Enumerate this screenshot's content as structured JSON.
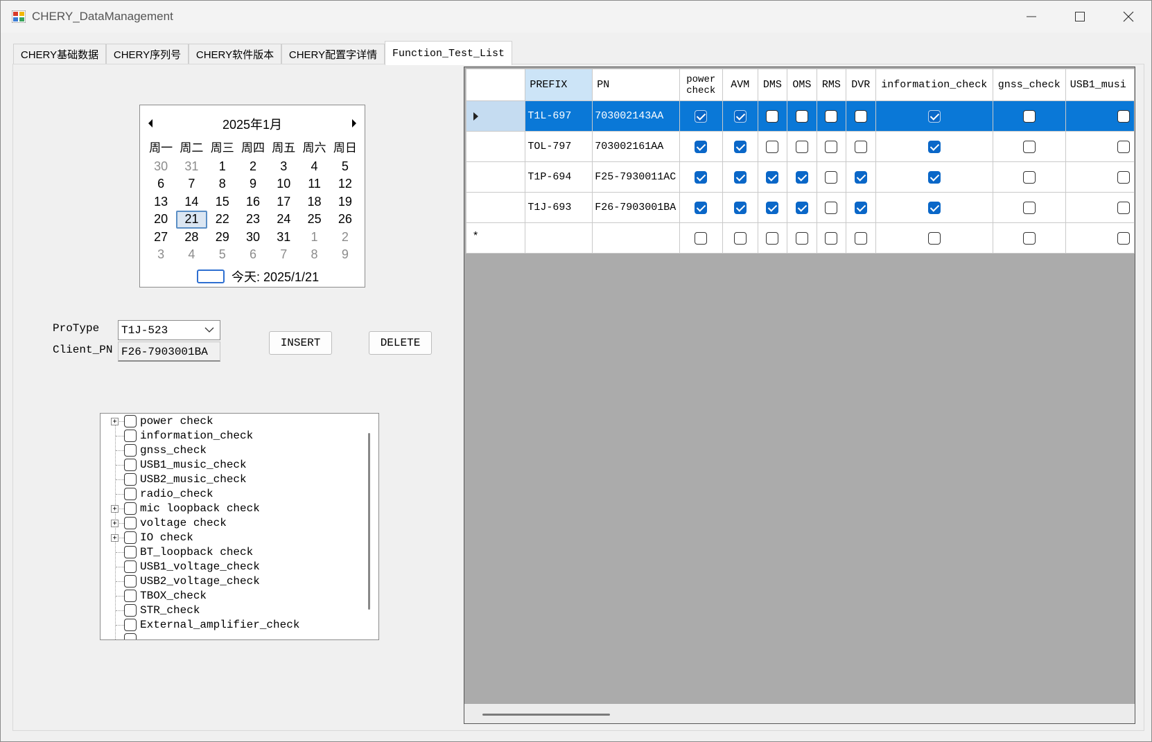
{
  "window": {
    "title": "CHERY_DataManagement"
  },
  "tabs": [
    {
      "label": "CHERY基础数据",
      "active": false
    },
    {
      "label": "CHERY序列号",
      "active": false
    },
    {
      "label": "CHERY软件版本",
      "active": false
    },
    {
      "label": "CHERY配置字详情",
      "active": false
    },
    {
      "label": "Function_Test_List",
      "active": true
    }
  ],
  "calendar": {
    "month_label": "2025年1月",
    "weekdays": [
      "周一",
      "周二",
      "周三",
      "周四",
      "周五",
      "周六",
      "周日"
    ],
    "weeks": [
      [
        "30",
        "31",
        "1",
        "2",
        "3",
        "4",
        "5"
      ],
      [
        "6",
        "7",
        "8",
        "9",
        "10",
        "11",
        "12"
      ],
      [
        "13",
        "14",
        "15",
        "16",
        "17",
        "18",
        "19"
      ],
      [
        "20",
        "21",
        "22",
        "23",
        "24",
        "25",
        "26"
      ],
      [
        "27",
        "28",
        "29",
        "30",
        "31",
        "1",
        "2"
      ],
      [
        "3",
        "4",
        "5",
        "6",
        "7",
        "8",
        "9"
      ]
    ],
    "today_label": "今天: 2025/1/21"
  },
  "form": {
    "protype_label": "ProType",
    "protype_value": "T1J-523",
    "client_pn_label": "Client_PN",
    "client_pn_value": "F26-7903001BA",
    "insert_label": "INSERT",
    "delete_label": "DELETE"
  },
  "tree": {
    "items": [
      {
        "label": "power check",
        "expandable": true
      },
      {
        "label": "information_check",
        "expandable": false
      },
      {
        "label": "gnss_check",
        "expandable": false
      },
      {
        "label": "USB1_music_check",
        "expandable": false
      },
      {
        "label": "USB2_music_check",
        "expandable": false
      },
      {
        "label": "radio_check",
        "expandable": false
      },
      {
        "label": "mic loopback check",
        "expandable": true
      },
      {
        "label": "voltage check",
        "expandable": true
      },
      {
        "label": "IO check",
        "expandable": true
      },
      {
        "label": "BT_loopback check",
        "expandable": false
      },
      {
        "label": "USB1_voltage_check",
        "expandable": false
      },
      {
        "label": "USB2_voltage_check",
        "expandable": false
      },
      {
        "label": "TBOX_check",
        "expandable": false
      },
      {
        "label": "STR_check",
        "expandable": false
      },
      {
        "label": "External_amplifier_check",
        "expandable": false
      }
    ]
  },
  "grid": {
    "columns": [
      "PREFIX",
      "PN",
      "power check",
      "AVM",
      "DMS",
      "OMS",
      "RMS",
      "DVR",
      "information_check",
      "gnss_check",
      "USB1_musi"
    ],
    "rows": [
      {
        "prefix": "T1L-697",
        "pn": "703002143AA",
        "checks": [
          true,
          true,
          false,
          false,
          false,
          false,
          true,
          false,
          false
        ],
        "selected": true
      },
      {
        "prefix": "TOL-797",
        "pn": "703002161AA",
        "checks": [
          true,
          true,
          false,
          false,
          false,
          false,
          true,
          false,
          false
        ],
        "selected": false
      },
      {
        "prefix": "T1P-694",
        "pn": "F25-7930011AC",
        "checks": [
          true,
          true,
          true,
          true,
          false,
          true,
          true,
          false,
          false
        ],
        "selected": false
      },
      {
        "prefix": "T1J-693",
        "pn": "F26-7903001BA",
        "checks": [
          true,
          true,
          true,
          true,
          false,
          true,
          true,
          false,
          false
        ],
        "selected": false
      }
    ],
    "new_row_marker": "*"
  }
}
